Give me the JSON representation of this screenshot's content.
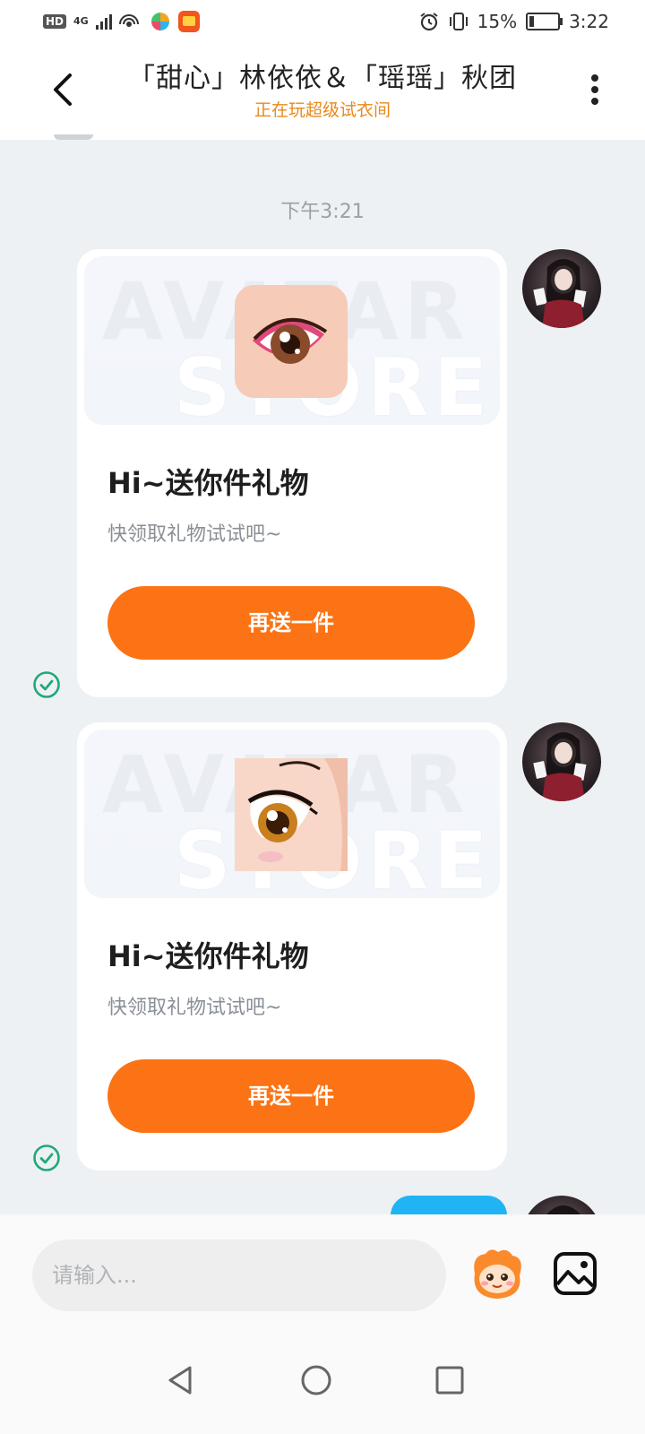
{
  "status_bar": {
    "hd_label": "HD",
    "network_label": "4G",
    "battery_percent": "15%",
    "battery_level": 0.15,
    "time": "3:22"
  },
  "header": {
    "title": "「甜心」林依依＆「瑶瑶」秋团",
    "subtitle": "正在玩超级试衣间",
    "accent_color": "#e8891c"
  },
  "chat": {
    "timestamp": "下午3:21",
    "watermark_top": "AVATAR",
    "watermark_bottom": "STORE",
    "cards": [
      {
        "image_icon": "pink-eyeshadow-eye-image",
        "title": "Hi~送你件礼物",
        "description": "快领取礼物试试吧~",
        "button_label": "再送一件"
      },
      {
        "image_icon": "anime-amber-eye-image",
        "title": "Hi~送你件礼物",
        "description": "快领取礼物试试吧~",
        "button_label": "再送一件"
      }
    ],
    "button_color": "#fb7314",
    "sent_status_icon": "check-circle-icon",
    "sent_status_color": "#21a87a"
  },
  "input_bar": {
    "placeholder": "请输入..."
  }
}
